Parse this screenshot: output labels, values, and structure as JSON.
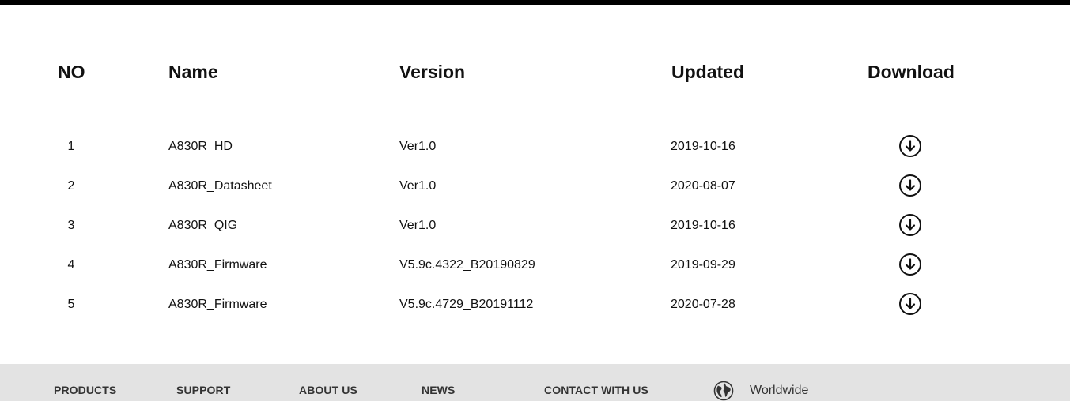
{
  "table": {
    "headers": {
      "no": "NO",
      "name": "Name",
      "version": "Version",
      "updated": "Updated",
      "download": "Download"
    },
    "rows": [
      {
        "no": "1",
        "name": "A830R_HD",
        "version": "Ver1.0",
        "updated": "2019-10-16"
      },
      {
        "no": "2",
        "name": "A830R_Datasheet",
        "version": "Ver1.0",
        "updated": "2020-08-07"
      },
      {
        "no": "3",
        "name": "A830R_QIG",
        "version": "Ver1.0",
        "updated": "2019-10-16"
      },
      {
        "no": "4",
        "name": "A830R_Firmware",
        "version": "V5.9c.4322_B20190829",
        "updated": "2019-09-29"
      },
      {
        "no": "5",
        "name": "A830R_Firmware",
        "version": "V5.9c.4729_B20191112",
        "updated": "2020-07-28"
      }
    ],
    "download_icon": "download-circle-icon"
  },
  "footer": {
    "links": [
      "PRODUCTS",
      "SUPPORT",
      "ABOUT US",
      "NEWS",
      "CONTACT WITH US"
    ],
    "region_icon": "globe-icon",
    "region_label": "Worldwide"
  },
  "colors": {
    "top_bar": "#000000",
    "footer_bg": "#e3e3e3",
    "text": "#111111",
    "footer_text": "#333333"
  }
}
